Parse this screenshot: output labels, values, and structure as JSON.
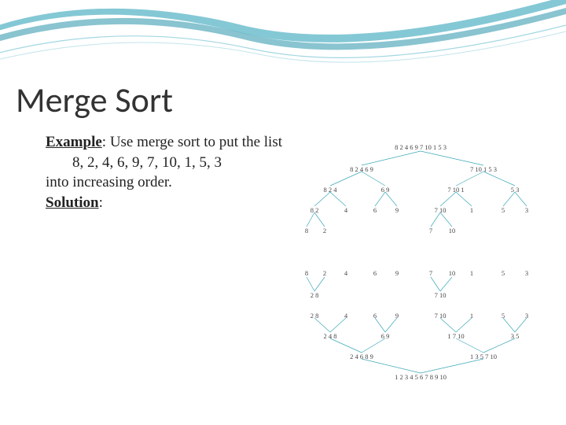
{
  "title": "Merge Sort",
  "example_label": "Example",
  "example_colon": ":",
  "example_text": " Use merge sort to put the list",
  "list_line": "8, 2, 4, 6, 9, 7, 10, 1, 5, 3",
  "order_line": "into increasing order.",
  "solution_label": "Solution",
  "solution_colon": ":",
  "tree": {
    "l0": "8 2 4 6 9 7 10 1 5 3",
    "l1a": "8 2 4 6 9",
    "l1b": "7 10 1 5 3",
    "l2a": "8 2 4",
    "l2b": "6 9",
    "l2c": "7 10 1",
    "l2d": "5 3",
    "l3a": "8 2",
    "l3b": "4",
    "l3c": "6",
    "l3d": "9",
    "l3e": "7 10",
    "l3f": "1",
    "l3g": "5",
    "l3h": "3",
    "l4a": "8",
    "l4b": "2",
    "l4c": "7",
    "l4d": "10",
    "m4a": "8",
    "m4b": "2",
    "m4c": "4",
    "m4d": "6",
    "m4e": "9",
    "m4f": "7",
    "m4g": "10",
    "m4h": "1",
    "m4i": "5",
    "m4j": "3",
    "m3a": "2 8",
    "m3b": "4",
    "m3c": "6",
    "m3d": "9",
    "m3e": "7 10",
    "m3f": "1",
    "m3g": "5",
    "m3h": "3",
    "m2a": "2 4 8",
    "m2b": "6 9",
    "m2c": "1 7 10",
    "m2d": "3 5",
    "m1a": "2 4 6 8 9",
    "m1b": "1 3 5 7 10",
    "m0": "1 2 3 4 5 6 7 8 9 10"
  }
}
